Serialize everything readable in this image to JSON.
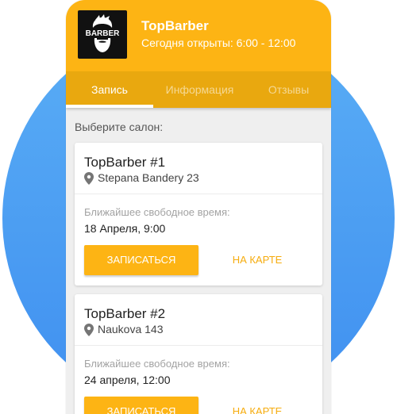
{
  "header": {
    "title": "TopBarber",
    "subtitle": "Сегодня открыты: 6:00 - 12:00",
    "logo_text": "BARBER"
  },
  "tabs": [
    {
      "label": "Запись",
      "active": true
    },
    {
      "label": "Информация",
      "active": false
    },
    {
      "label": "Отзывы",
      "active": false
    }
  ],
  "prompt": "Выберите салон:",
  "salons": [
    {
      "name": "TopBarber #1",
      "address": "Stepana Bandery 23",
      "free_label": "Ближайшее свободное время:",
      "free_time": "18 Апреля, 9:00",
      "book_label": "ЗАПИСАТЬСЯ",
      "map_label": "НА КАРТЕ"
    },
    {
      "name": "TopBarber #2",
      "address": "Naukova 143",
      "free_label": "Ближайшее свободное время:",
      "free_time": "24 апреля, 12:00",
      "book_label": "ЗАПИСАТЬСЯ",
      "map_label": "НА КАРТЕ"
    }
  ],
  "colors": {
    "accent": "#fdb414",
    "tab_bar": "#e9a80f",
    "background_circle": "#4a9cf3"
  },
  "icons": [
    "logo-barber-icon",
    "location-pin-icon"
  ]
}
